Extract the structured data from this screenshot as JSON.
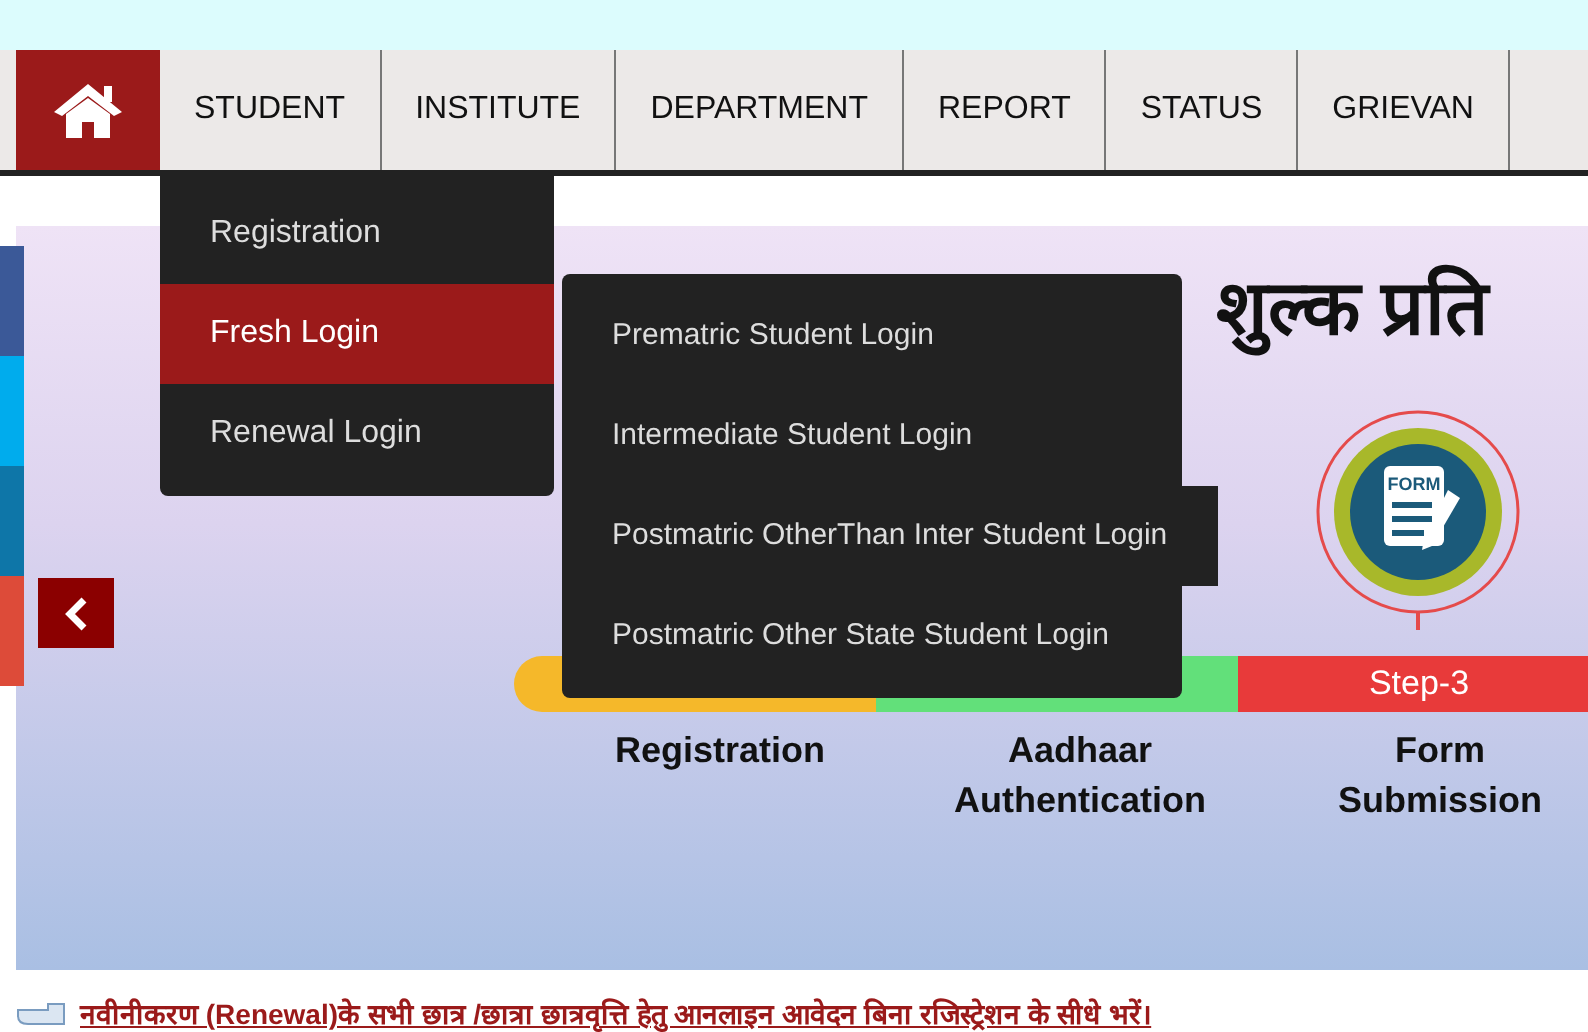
{
  "nav": {
    "home_selected": true,
    "items": [
      {
        "label": "STUDENT",
        "selected": false
      },
      {
        "label": "INSTITUTE",
        "selected": false
      },
      {
        "label": "DEPARTMENT",
        "selected": false
      },
      {
        "label": "REPORT",
        "selected": false
      },
      {
        "label": "STATUS",
        "selected": false
      },
      {
        "label": "GRIEVAN",
        "selected": false
      }
    ]
  },
  "dropdown": {
    "items": [
      {
        "label": "Registration",
        "selected": false
      },
      {
        "label": "Fresh Login",
        "selected": true
      },
      {
        "label": "Renewal Login",
        "selected": false
      }
    ]
  },
  "submenu": {
    "items": [
      {
        "label": "Prematric Student Login"
      },
      {
        "label": "Intermediate Student Login"
      },
      {
        "label": "Postmatric OtherThan Inter Student Login"
      },
      {
        "label": "Postmatric Other State Student Login"
      }
    ]
  },
  "social_buttons": [
    {
      "color": "#3b5998"
    },
    {
      "color": "#00aced"
    },
    {
      "color": "#0e76a8"
    },
    {
      "color": "#dd4b39"
    }
  ],
  "banner": {
    "title": "शुल्क प्रति",
    "step_bar": [
      {
        "color": "#f5b82a"
      },
      {
        "color": "#62e07a"
      },
      {
        "color": "#e83a3a",
        "label": "Step-3"
      }
    ],
    "steps": [
      "Registration",
      "Aadhaar Authentication",
      "Form Submission"
    ],
    "form_icon_text": "FORM"
  },
  "notice": "नवीनीकरण (Renewal)के सभी छात्र /छात्रा छात्रवृत्ति हेतु आनलाइन आवेदन बिना रजिस्ट्रेशन के सीधे भरें।"
}
